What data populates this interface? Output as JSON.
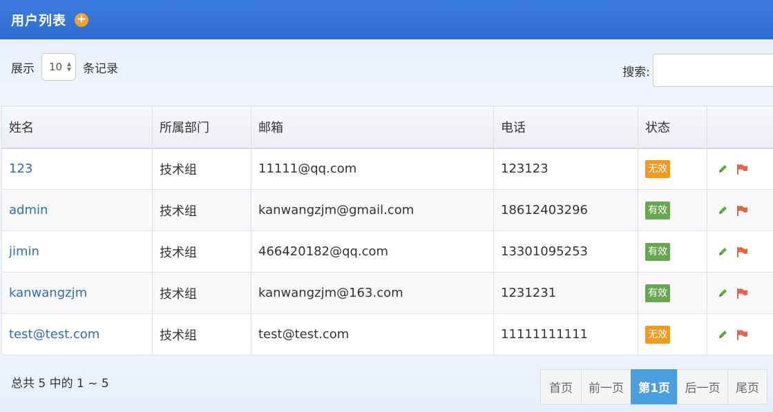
{
  "header": {
    "title": "用户列表",
    "add_icon": "plus-circle-icon"
  },
  "toolbar": {
    "length_prefix": "展示",
    "length_value": "10",
    "length_suffix": "条记录",
    "search_label": "搜索:"
  },
  "table": {
    "columns": [
      "姓名",
      "所属部门",
      "邮箱",
      "电话",
      "状态",
      ""
    ],
    "rows": [
      {
        "name": "123",
        "dept": "技术组",
        "email": "11111@qq.com",
        "phone": "123123",
        "status": "无效",
        "status_type": "invalid"
      },
      {
        "name": "admin",
        "dept": "技术组",
        "email": "kanwangzjm@gmail.com",
        "phone": "18612403296",
        "status": "有效",
        "status_type": "valid"
      },
      {
        "name": "jimin",
        "dept": "技术组",
        "email": "466420182@qq.com",
        "phone": "13301095253",
        "status": "有效",
        "status_type": "valid"
      },
      {
        "name": "kanwangzjm",
        "dept": "技术组",
        "email": "kanwangzjm@163.com",
        "phone": "1231231",
        "status": "有效",
        "status_type": "valid"
      },
      {
        "name": "test@test.com",
        "dept": "技术组",
        "email": "test@test.com",
        "phone": "11111111111",
        "status": "无效",
        "status_type": "invalid"
      }
    ]
  },
  "footer": {
    "info": "总共 5 中的 1 ~ 5",
    "pager": [
      {
        "label": "首页",
        "active": false
      },
      {
        "label": "前一页",
        "active": false
      },
      {
        "label": "第1页",
        "active": true
      },
      {
        "label": "后一页",
        "active": false
      },
      {
        "label": "尾页",
        "active": false
      }
    ]
  },
  "colors": {
    "header_bg": "#2f72d6",
    "link": "#2f6cb7",
    "invalid_badge": "#f29a1f",
    "valid_badge": "#67a751",
    "pager_active": "#4aa0de",
    "edit_icon": "#5cae3a",
    "flag_icon": "#e8624a"
  }
}
